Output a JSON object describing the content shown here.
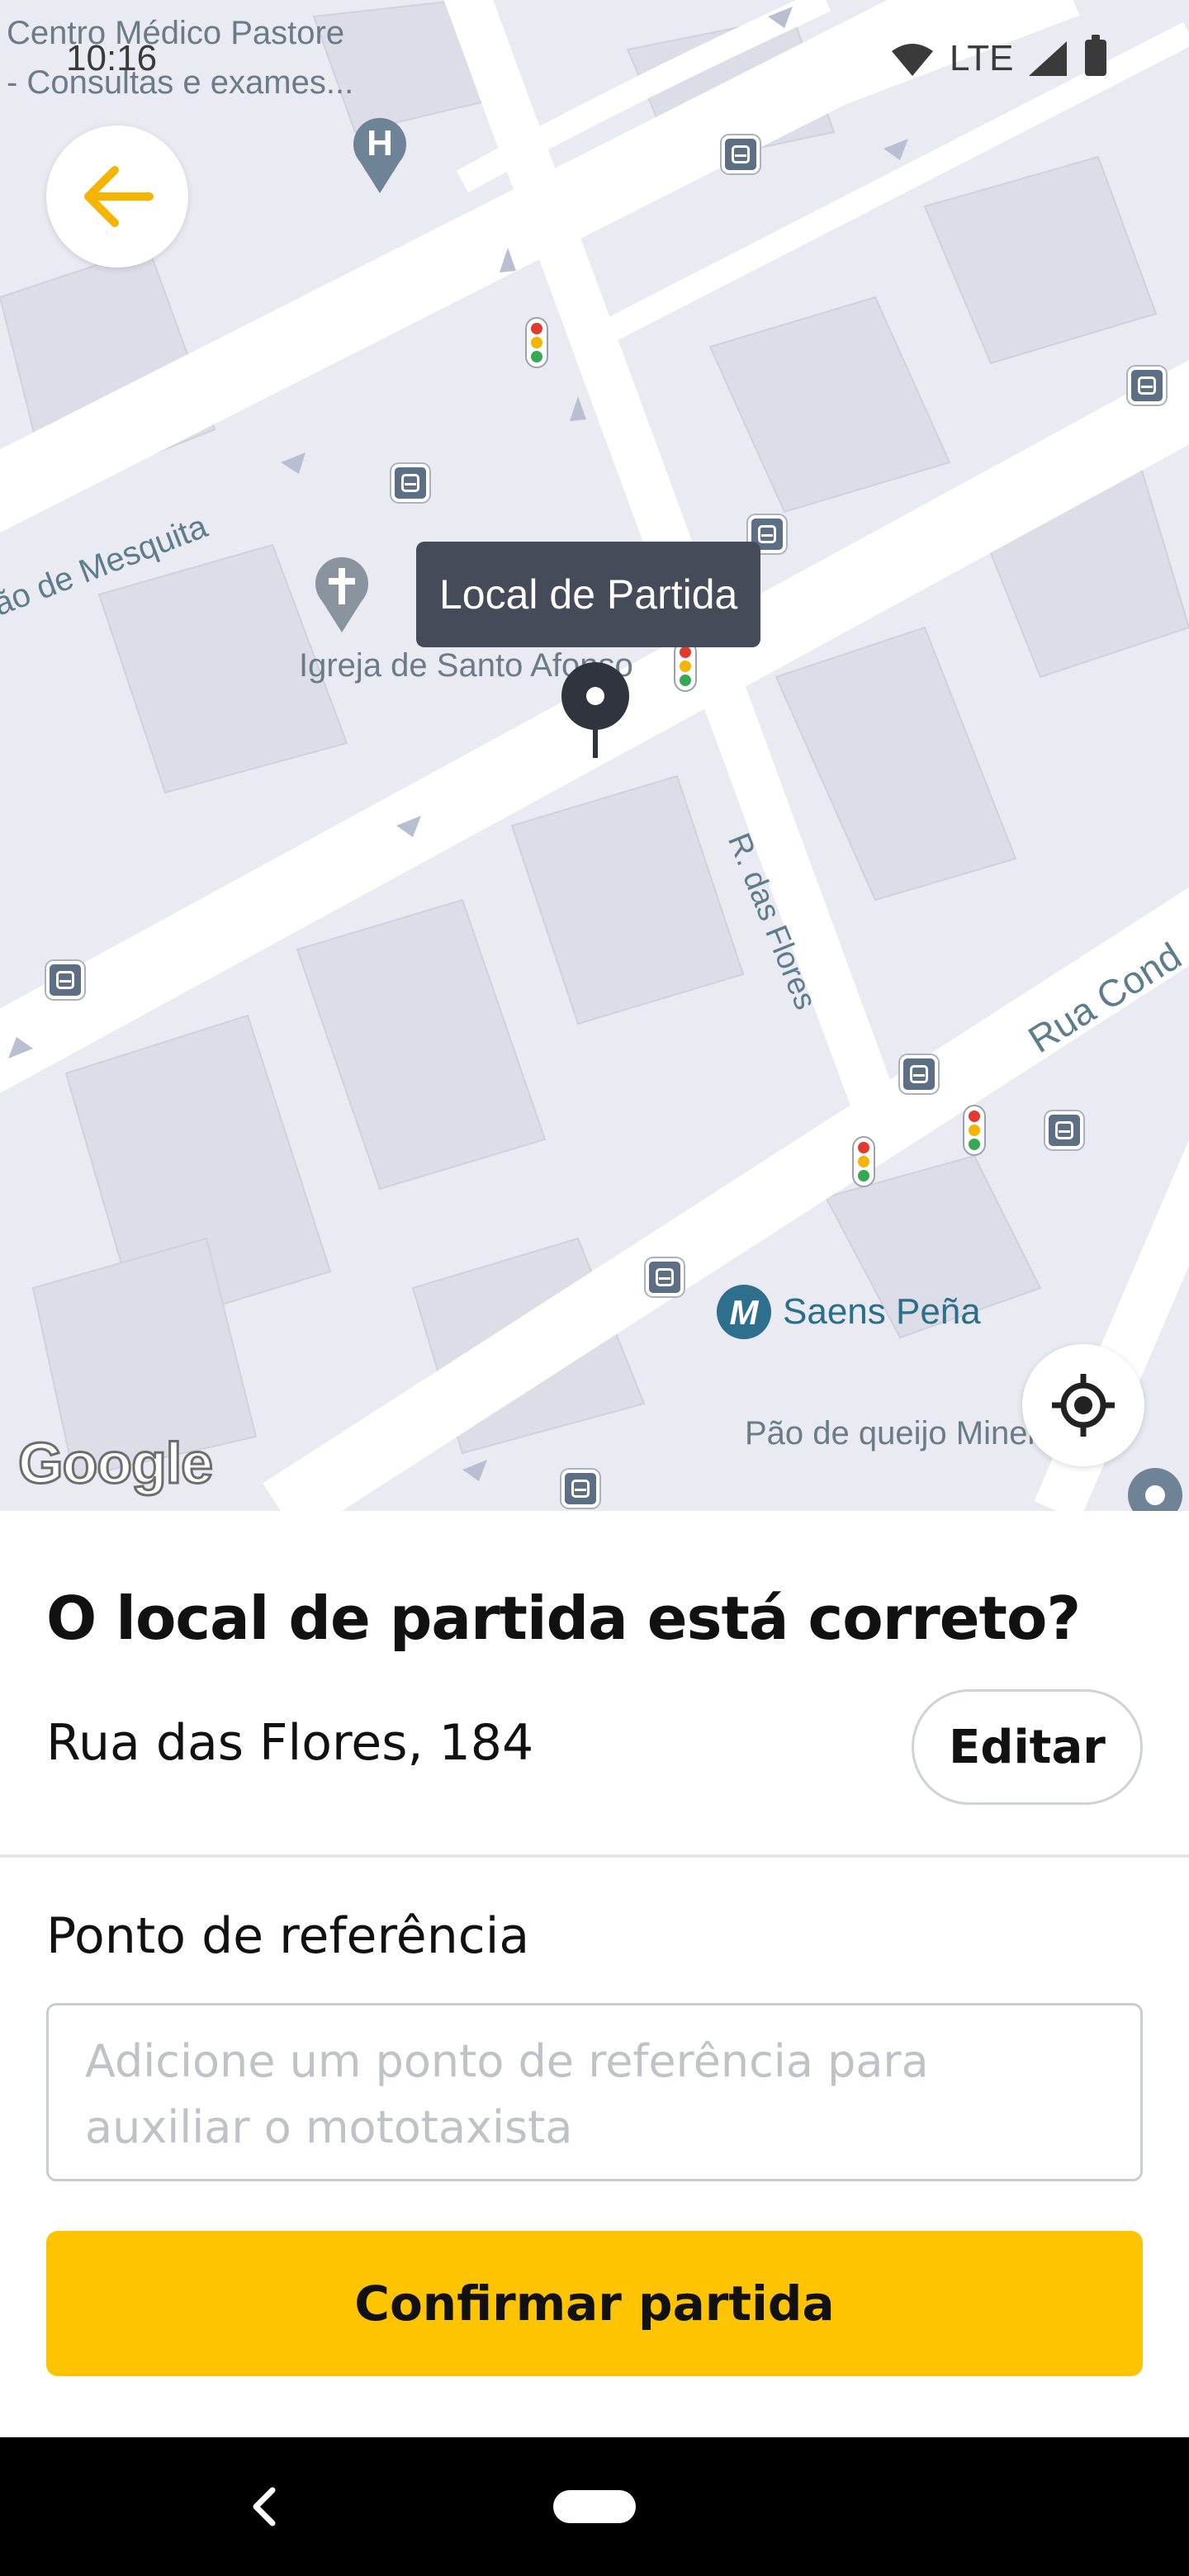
{
  "map": {
    "poi_top_label_line1": "Centro Médico Pastore",
    "poi_top_label_line2": "- Consultas e exames...",
    "church_label": "Igreja de Santo Afonso",
    "metro_label": "Saens Peña",
    "bakery_label": "Pão de queijo Mineiraria",
    "street_mesquita": "ão de Mesquita",
    "street_flores": "R. das Flores",
    "street_conde": "Rua Cond",
    "pickup_tooltip": "Local de Partida",
    "attribution": "Google",
    "hospital_icon_letter": "H",
    "metro_icon_letter": "M"
  },
  "status_bar": {
    "time": "10:16",
    "network": "LTE"
  },
  "sheet": {
    "title": "O local de partida está correto?",
    "address": "Rua das Flores, 184",
    "edit_label": "Editar",
    "reference_label": "Ponto de referência",
    "reference_placeholder": "Adicione um ponto de referência para auxiliar o mototaxista",
    "confirm_label": "Confirmar partida"
  },
  "colors": {
    "accent": "#ffc400",
    "tooltip_bg": "#454b58",
    "map_bg": "#e9eaf2",
    "road": "#ffffff"
  },
  "icons": {
    "back": "arrow-left-icon",
    "locate": "crosshair-icon",
    "pin": "location-pin-icon",
    "nav_back": "chevron-left-icon"
  }
}
